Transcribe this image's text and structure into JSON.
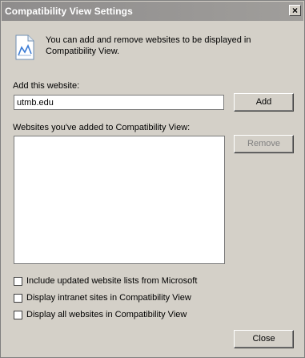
{
  "window": {
    "title": "Compatibility View Settings",
    "close_glyph": "×"
  },
  "info": {
    "icon": "page-document-icon",
    "text": "You can add and remove websites to be displayed in Compatibility View."
  },
  "add_site": {
    "label": "Add this website:",
    "value": "utmb.edu",
    "button": "Add"
  },
  "site_list": {
    "label": "Websites you've added to Compatibility View:",
    "items": [],
    "remove_button": "Remove",
    "remove_enabled": false
  },
  "options": [
    {
      "label": "Include updated website lists from Microsoft",
      "checked": false
    },
    {
      "label": "Display intranet sites in Compatibility View",
      "checked": false
    },
    {
      "label": "Display all websites in Compatibility View",
      "checked": false
    }
  ],
  "footer": {
    "close_button": "Close"
  }
}
